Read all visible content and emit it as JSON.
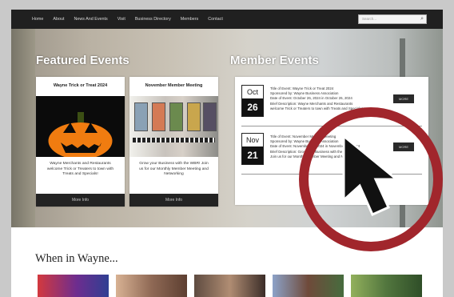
{
  "nav": {
    "items": [
      "Home",
      "About",
      "News And Events",
      "Visit",
      "Business Directory",
      "Members",
      "Contact"
    ],
    "search_placeholder": "Search..."
  },
  "featured": {
    "title": "Featured Events",
    "cards": [
      {
        "title": "Wayne Trick or Treat 2024",
        "text": "Wayne Merchants and Restaurants welcome Trick or Treaters to town with Treats and Specials!",
        "button": "More Info"
      },
      {
        "title": "November Member Meeting",
        "text": "Grow your Business with the WBR! Join us for our Monthly Member Meeting and Networking",
        "button": "More Info"
      }
    ]
  },
  "member_events": {
    "title": "Member Events",
    "events": [
      {
        "month": "Oct",
        "day": "26",
        "lines": [
          "Title of Event: Wayne Trick or Treat 2024",
          "Sponsored by: Wayne Business Association",
          "Date of Event: October 26, 2024 in October 26, 2024",
          "Brief Description: Wayne Merchants and Restaurants",
          "welcome Trick or Treaters to town with Treats and Specials!"
        ],
        "button": "MORE"
      },
      {
        "month": "Nov",
        "day": "21",
        "lines": [
          "Title of Event: November Member Meeting",
          "Sponsored by: Wayne Business Association",
          "Date of Event: November 21, 2024 in November 21, 2024",
          "Brief Description: Grow your Business with the WBR",
          "Join us for our Monthly Member Meeting and Networking"
        ],
        "button": "MORE"
      }
    ]
  },
  "when_in_wayne": {
    "title": "When in Wayne..."
  },
  "colors": {
    "nav_bg": "#202020",
    "ring": "#a1262c",
    "button_bg": "#232323"
  }
}
